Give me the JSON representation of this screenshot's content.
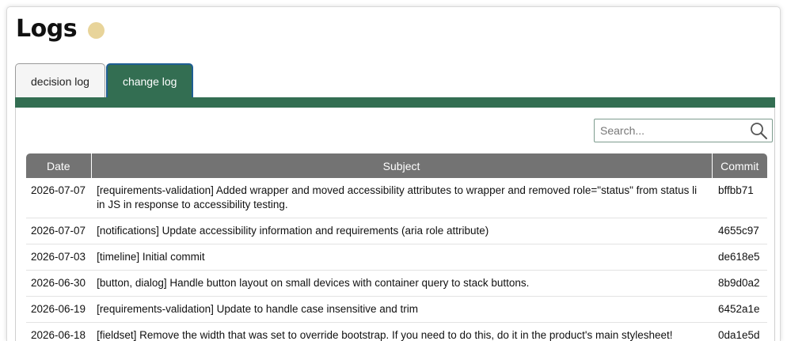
{
  "header": {
    "title": "Logs",
    "status_dot_color": "#e8d49a"
  },
  "tabs": [
    {
      "label": "decision log",
      "active": false
    },
    {
      "label": "change log",
      "active": true
    }
  ],
  "colors": {
    "accent_green": "#336e52",
    "header_gray": "#737373",
    "active_tab_border": "#1f5e93"
  },
  "search": {
    "placeholder": "Search...",
    "icon": "search-icon"
  },
  "table": {
    "columns": [
      "Date",
      "Subject",
      "Commit"
    ],
    "rows": [
      {
        "date": "2026-07-07",
        "subject": "[requirements-validation] Added wrapper and moved accessibility attributes to wrapper and removed role=\"status\" from status li in JS in response to accessibility testing.",
        "commit": "bffbb71"
      },
      {
        "date": "2026-07-07",
        "subject": "[notifications] Update accessibility information and requirements (aria role attribute)",
        "commit": "4655c97"
      },
      {
        "date": "2026-07-03",
        "subject": "[timeline] Initial commit",
        "commit": "de618e5"
      },
      {
        "date": "2026-06-30",
        "subject": "[button, dialog] Handle button layout on small devices with container query to stack buttons.",
        "commit": "8b9d0a2"
      },
      {
        "date": "2026-06-19",
        "subject": "[requirements-validation] Update to handle case insensitive and trim",
        "commit": "6452a1e"
      },
      {
        "date": "2026-06-18",
        "subject": "[fieldset] Remove the width that was set to override bootstrap. If you need to do this, do it in the product's main stylesheet!",
        "commit": "0da1e5d"
      }
    ]
  }
}
